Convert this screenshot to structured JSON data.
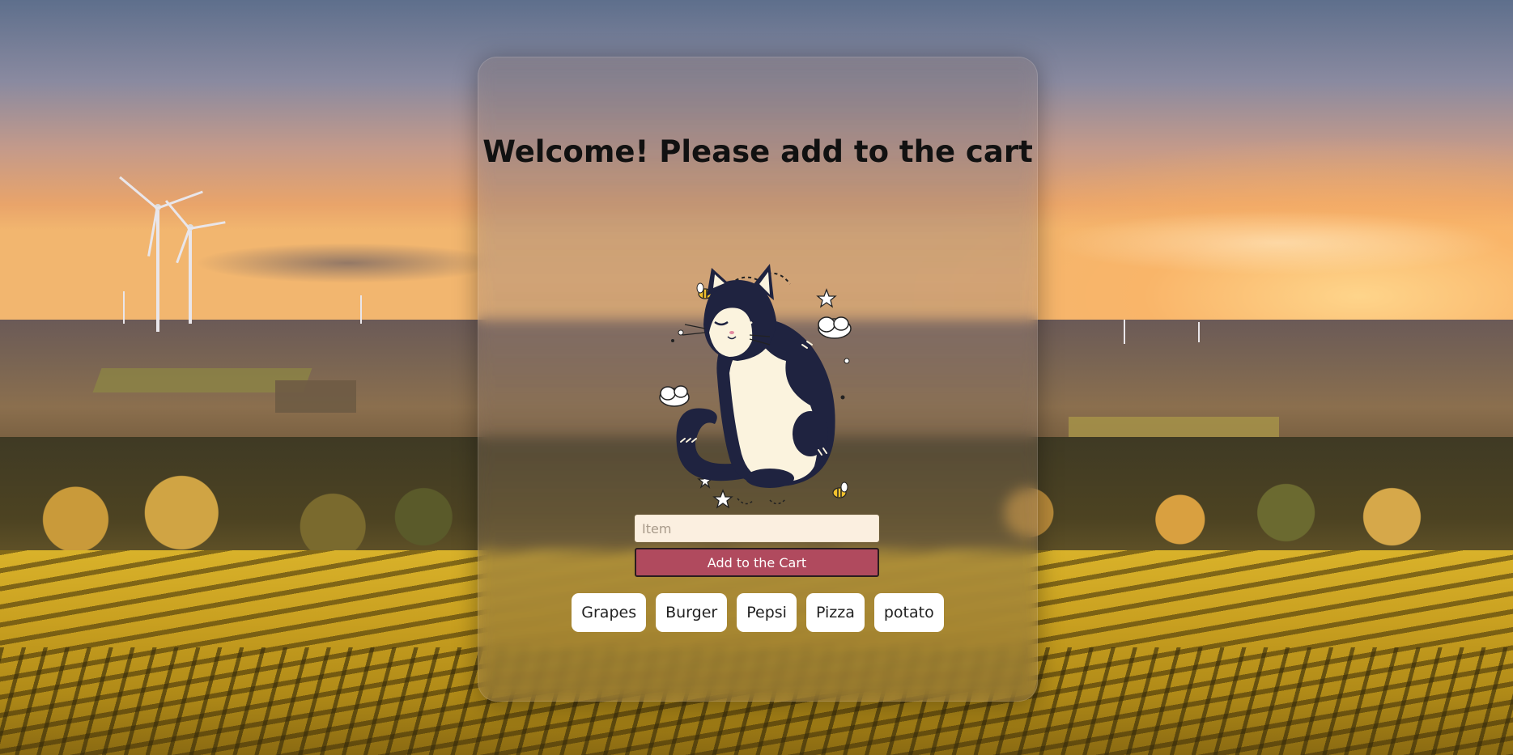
{
  "page": {
    "title": "Welcome! Please add to the cart"
  },
  "form": {
    "item_placeholder": "Item",
    "item_value": "",
    "add_button_label": "Add to the Cart"
  },
  "cart": {
    "items": [
      "Grapes",
      "Burger",
      "Pepsi",
      "Pizza",
      "potato"
    ]
  },
  "colors": {
    "button_bg": "#b04a5e",
    "input_bg": "#fbefe0",
    "chip_bg": "#ffffff"
  },
  "illustration": {
    "name": "cat-illustration-icon"
  }
}
